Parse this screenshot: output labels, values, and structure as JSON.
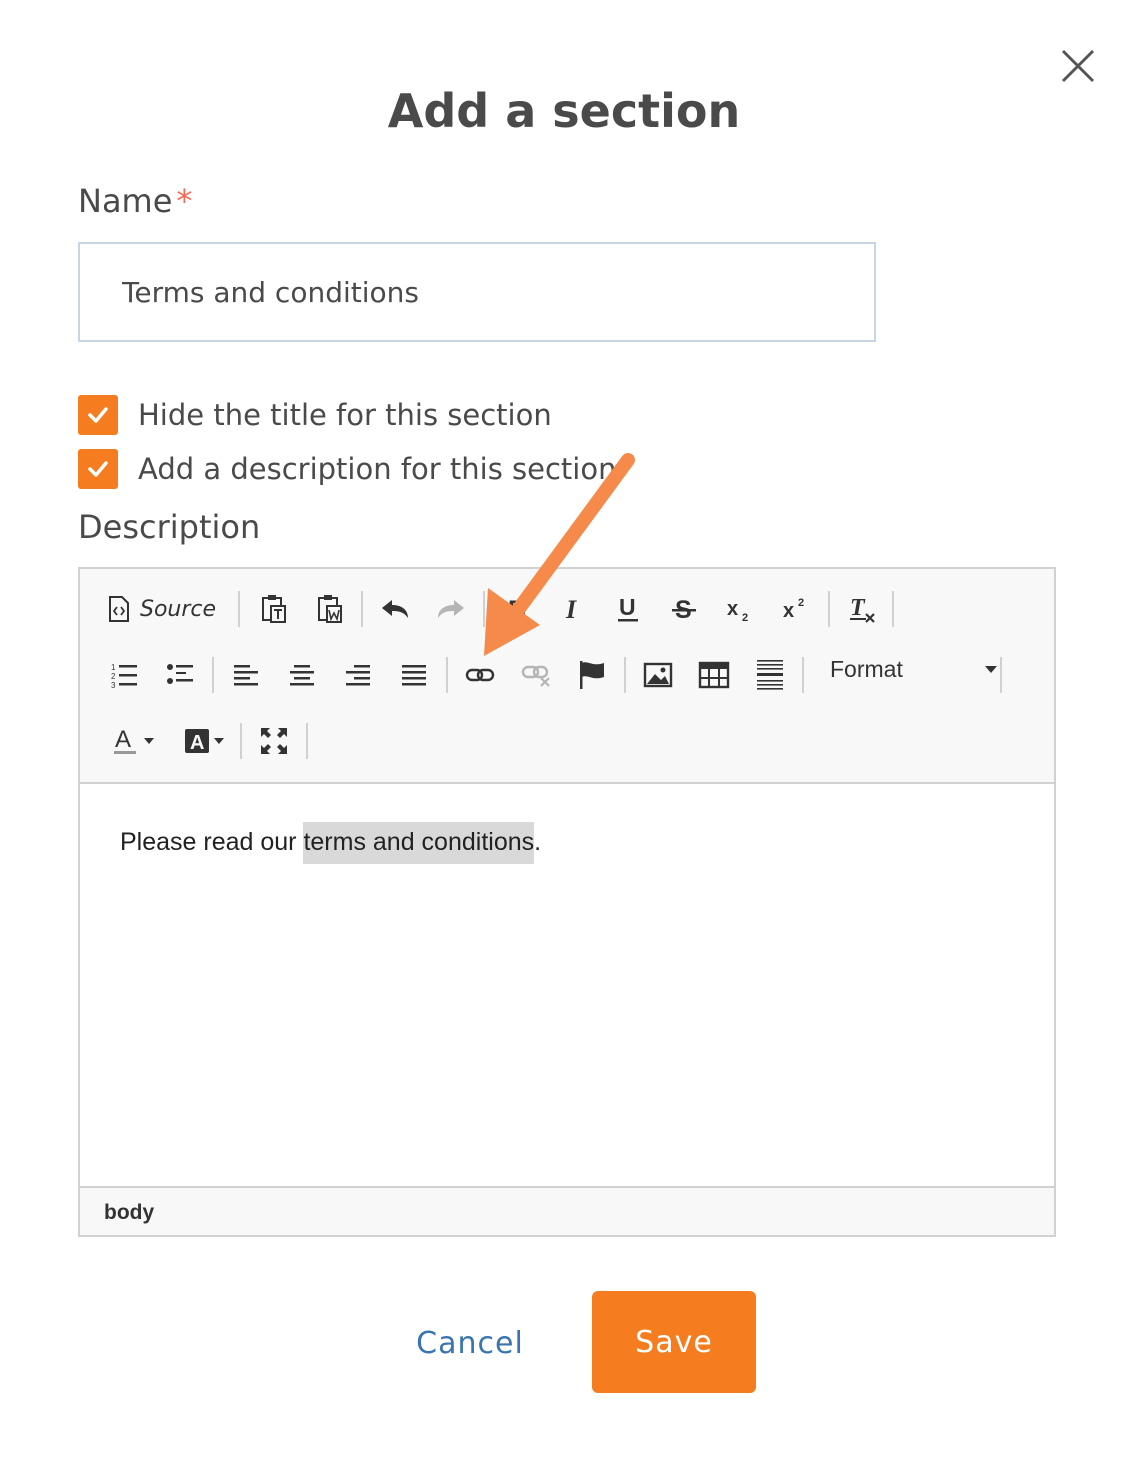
{
  "dialog": {
    "title": "Add a section",
    "close_icon": "close-icon"
  },
  "name_field": {
    "label": "Name",
    "required_marker": "*",
    "value": "Terms and conditions"
  },
  "checkboxes": [
    {
      "label": "Hide the title for this section",
      "checked": true
    },
    {
      "label": "Add a description for this section",
      "checked": true
    }
  ],
  "description": {
    "label": "Description",
    "toolbar": {
      "source_label": "Source",
      "format_label": "Format",
      "icons": [
        "source-icon",
        "paste-text-icon",
        "paste-word-icon",
        "undo-icon",
        "redo-icon",
        "bold-icon",
        "italic-icon",
        "underline-icon",
        "strikethrough-icon",
        "subscript-icon",
        "superscript-icon",
        "remove-format-icon",
        "numbered-list-icon",
        "bulleted-list-icon",
        "align-left-icon",
        "align-center-icon",
        "align-right-icon",
        "justify-icon",
        "link-icon",
        "unlink-icon",
        "anchor-icon",
        "image-icon",
        "table-icon",
        "horizontal-line-icon",
        "text-color-icon",
        "background-color-icon",
        "maximize-icon"
      ]
    },
    "content": {
      "before": "Please read our ",
      "selected": "terms and conditions",
      "after": "."
    },
    "element_path": "body"
  },
  "actions": {
    "cancel_label": "Cancel",
    "save_label": "Save"
  },
  "colors": {
    "accent": "#f57d1f",
    "link": "#3a75b0",
    "required": "#f06a55",
    "annotation_arrow": "#f58a4a"
  }
}
